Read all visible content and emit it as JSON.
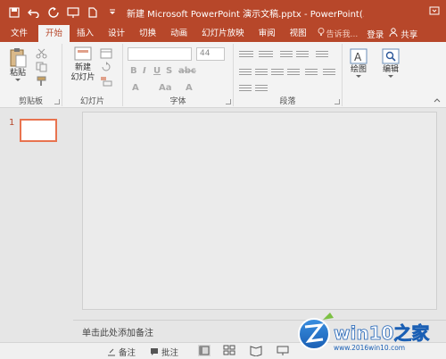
{
  "titlebar": {
    "title": "新建 Microsoft PowerPoint 演示文稿.pptx - PowerPoint(..."
  },
  "tabs": [
    {
      "label": "文件"
    },
    {
      "label": "开始"
    },
    {
      "label": "插入"
    },
    {
      "label": "设计"
    },
    {
      "label": "切换"
    },
    {
      "label": "动画"
    },
    {
      "label": "幻灯片放映"
    },
    {
      "label": "审阅"
    },
    {
      "label": "视图"
    }
  ],
  "tell_me": "告诉我...",
  "login": "登录",
  "share": "共享",
  "ribbon": {
    "clipboard": {
      "paste": "粘贴",
      "label": "剪贴板"
    },
    "slides": {
      "new_slide_line1": "新建",
      "new_slide_line2": "幻灯片",
      "label": "幻灯片"
    },
    "font": {
      "size": "44",
      "label": "字体"
    },
    "paragraph": {
      "label": "段落"
    },
    "drawing": {
      "label": "绘图"
    },
    "editing": {
      "label": "编辑"
    }
  },
  "slides": {
    "number": "1"
  },
  "notes": {
    "placeholder": "单击此处添加备注"
  },
  "statusbar": {
    "notes": "备注",
    "comments": "批注"
  },
  "watermark": {
    "brand": "win10之家",
    "url": "www.2016win10.com"
  },
  "colors": {
    "accent": "#b7472a",
    "tab_active_bg": "#f3f3f3",
    "thumb_border": "#e8734f"
  }
}
